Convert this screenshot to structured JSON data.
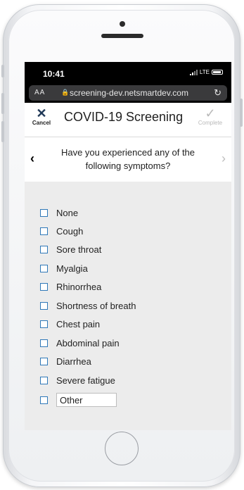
{
  "status": {
    "time": "10:41",
    "network": "LTE"
  },
  "browser": {
    "aa": "AA",
    "url": "screening-dev.netsmartdev.com"
  },
  "header": {
    "cancel_label": "Cancel",
    "title": "COVID-19 Screening",
    "complete_label": "Complete"
  },
  "question": {
    "text": "Have you experienced any of the following symptoms?"
  },
  "symptoms": [
    {
      "label": "None"
    },
    {
      "label": "Cough"
    },
    {
      "label": "Sore throat"
    },
    {
      "label": "Myalgia"
    },
    {
      "label": "Rhinorrhea"
    },
    {
      "label": "Shortness of breath"
    },
    {
      "label": "Chest pain"
    },
    {
      "label": "Abdominal pain"
    },
    {
      "label": "Diarrhea"
    },
    {
      "label": "Severe fatigue"
    }
  ],
  "other": {
    "value": "Other"
  },
  "colors": {
    "checkbox_border": "#2f78b8",
    "cancel_icon": "#1e3756",
    "complete_disabled": "#b9b9b9"
  }
}
